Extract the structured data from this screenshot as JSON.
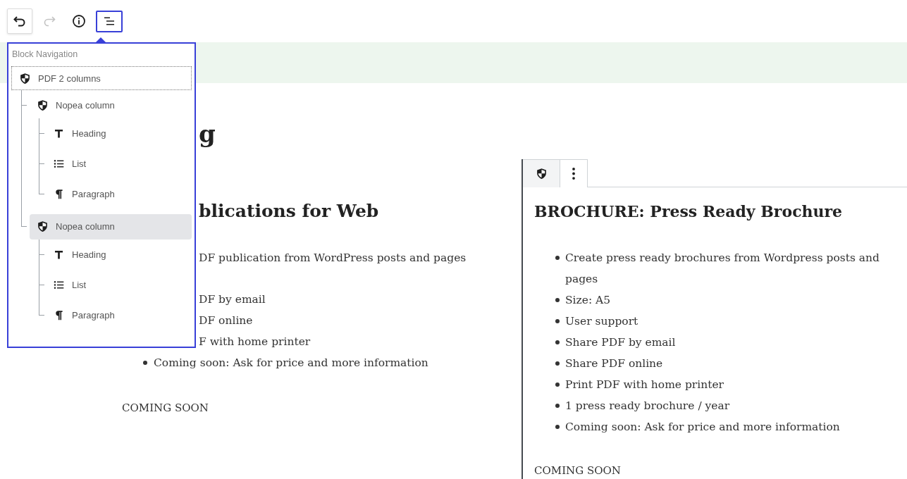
{
  "toolbar": {
    "buttons": [
      {
        "kind": "undo",
        "disabled": false,
        "focused": true,
        "pressed": false
      },
      {
        "kind": "redo",
        "disabled": true,
        "focused": false,
        "pressed": false
      },
      {
        "kind": "info",
        "disabled": false,
        "focused": false,
        "pressed": false
      },
      {
        "kind": "outline",
        "disabled": false,
        "focused": false,
        "pressed": true
      }
    ]
  },
  "block_navigation": {
    "title": "Block Navigation",
    "items": [
      {
        "label": "PDF 2 columns",
        "kind": "shield",
        "focused": true,
        "highlighted": false,
        "children": [
          {
            "label": "Nopea column",
            "kind": "shield",
            "focused": false,
            "highlighted": false,
            "children": [
              {
                "label": "Heading",
                "kind": "heading",
                "focused": false,
                "highlighted": false
              },
              {
                "label": "List",
                "kind": "list",
                "focused": false,
                "highlighted": false
              },
              {
                "label": "Paragraph",
                "kind": "paragraph",
                "focused": false,
                "highlighted": false
              }
            ]
          },
          {
            "label": "Nopea column",
            "kind": "shield",
            "focused": false,
            "highlighted": true,
            "children": [
              {
                "label": "Heading",
                "kind": "heading",
                "focused": false,
                "highlighted": false
              },
              {
                "label": "List",
                "kind": "list",
                "focused": false,
                "highlighted": false
              },
              {
                "label": "Paragraph",
                "kind": "paragraph",
                "focused": false,
                "highlighted": false
              }
            ]
          }
        ]
      }
    ]
  },
  "left_column": {
    "blocks": [
      {
        "kind": "title",
        "text": "g"
      },
      {
        "kind": "heading",
        "text": "blications for Web"
      },
      {
        "kind": "paragraph",
        "text": "DF publication from WordPress posts and pages"
      },
      {
        "kind": "list",
        "items": [
          {
            "text": "DF by email",
            "bullet": false
          },
          {
            "text": "DF online",
            "bullet": false
          },
          {
            "text": "F with home printer",
            "bullet": false
          },
          {
            "text": "Coming soon: Ask for price and more information",
            "bullet": true
          }
        ]
      },
      {
        "kind": "note",
        "text": "COMING SOON"
      }
    ]
  },
  "right_column": {
    "block_toolbar": [
      {
        "kind": "shield",
        "highlighted": true
      },
      {
        "kind": "more",
        "highlighted": false
      }
    ],
    "blocks": [
      {
        "kind": "heading",
        "text": "BROCHURE: Press Ready Brochure"
      },
      {
        "kind": "list",
        "items": [
          {
            "text": "Create press ready brochures from Wordpress posts and pages",
            "bullet": true
          },
          {
            "text": "Size: A5",
            "bullet": true
          },
          {
            "text": "User support",
            "bullet": true
          },
          {
            "text": "Share PDF by email",
            "bullet": true
          },
          {
            "text": "Share PDF online",
            "bullet": true
          },
          {
            "text": "Print PDF with home printer",
            "bullet": true
          },
          {
            "text": "1 press ready brochure / year",
            "bullet": true
          },
          {
            "text": "Coming soon: Ask for price and more information",
            "bullet": true
          }
        ]
      },
      {
        "kind": "note",
        "text": "COMING SOON"
      }
    ]
  }
}
